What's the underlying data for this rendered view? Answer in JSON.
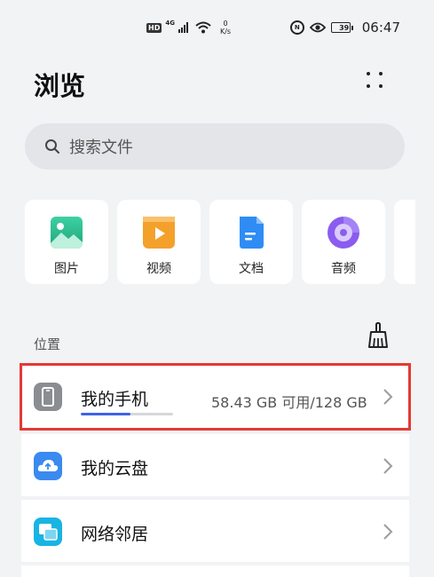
{
  "status_bar": {
    "hd": "HD",
    "network": "4G",
    "speed_value": "0",
    "speed_unit": "K/s",
    "battery": "39",
    "time": "06:47"
  },
  "header": {
    "title": "浏览"
  },
  "search": {
    "placeholder": "搜索文件"
  },
  "categories": [
    {
      "label": "图片",
      "icon": "image-icon",
      "color": "#2bb58a"
    },
    {
      "label": "视频",
      "icon": "video-icon",
      "color": "#f4a12c"
    },
    {
      "label": "文档",
      "icon": "document-icon",
      "color": "#2f8cf5"
    },
    {
      "label": "音频",
      "icon": "audio-icon",
      "color": "#8a5cf0"
    }
  ],
  "locations": {
    "section_label": "位置",
    "items": [
      {
        "label": "我的手机",
        "icon": "phone-icon",
        "storage": "58.43 GB 可用/128 GB",
        "used_fraction": 0.54,
        "color": "#8a8d92"
      },
      {
        "label": "我的云盘",
        "icon": "cloud-icon",
        "color": "#3a8af0"
      },
      {
        "label": "网络邻居",
        "icon": "network-icon",
        "color": "#18b4e3"
      }
    ]
  },
  "accent": "#3c63e5",
  "highlight_color": "#e53935"
}
